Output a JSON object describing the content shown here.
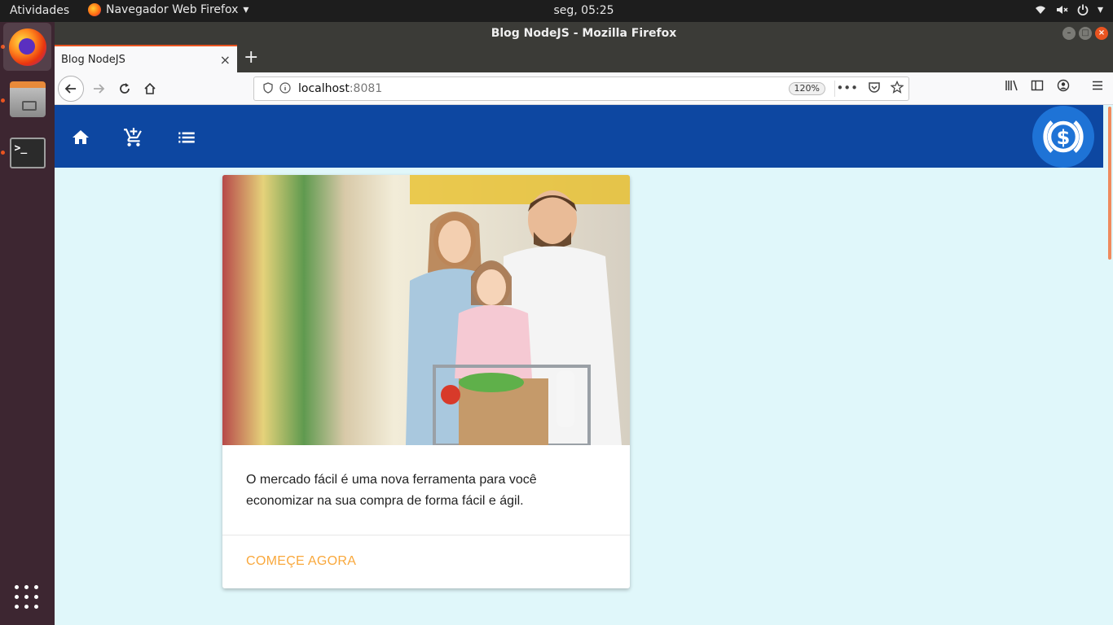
{
  "desktop": {
    "activities_label": "Atividades",
    "app_menu_label": "Navegador Web Firefox",
    "clock": "seg, 05:25",
    "dock_items": [
      "firefox-icon",
      "files-icon",
      "terminal-icon"
    ]
  },
  "window": {
    "title": "Blog NodeJS - Mozilla Firefox"
  },
  "tabs": [
    {
      "title": "Blog NodeJS",
      "close": "×"
    }
  ],
  "toolbar": {
    "new_tab": "+",
    "url_host": "localhost",
    "url_port": ":8081",
    "zoom": "120%",
    "more": "•••"
  },
  "page": {
    "appbar": {
      "icons": [
        "home-icon",
        "add-shopping-cart-icon",
        "list-icon"
      ],
      "logo": "dollar-coin-icon",
      "color": "#0d47a1"
    },
    "card": {
      "image": "family-supermarket-photo",
      "text": "O mercado fácil é uma nova ferramenta para você economizar na sua compra de forma fácil e ágil.",
      "action_label": "COMEÇE AGORA",
      "action_color": "#f9a83c"
    },
    "background_color": "#e0f7fa"
  }
}
